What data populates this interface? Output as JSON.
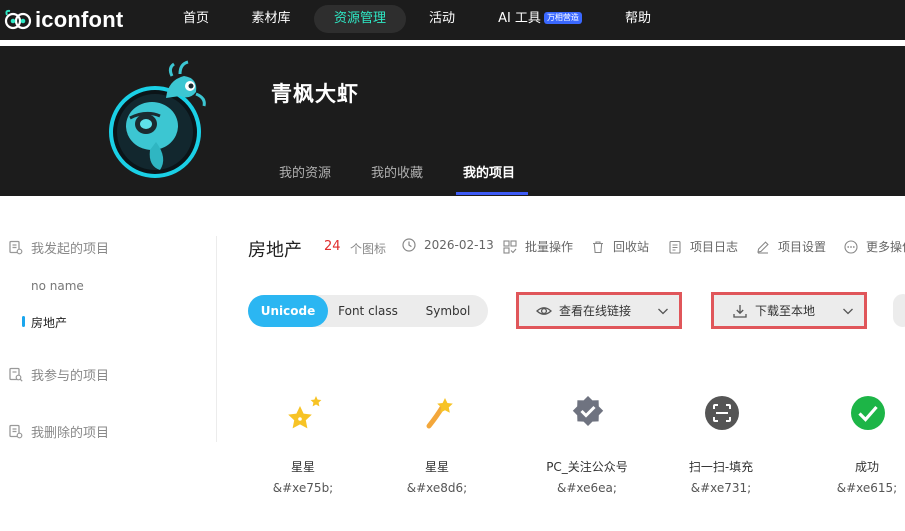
{
  "brand": {
    "name": "iconfont"
  },
  "topnav": {
    "items": [
      {
        "label": "首页"
      },
      {
        "label": "素材库"
      },
      {
        "label": "资源管理"
      },
      {
        "label": "活动"
      },
      {
        "label": "AI 工具",
        "badge": "万相营造"
      },
      {
        "label": "帮助"
      }
    ],
    "active_index": 2
  },
  "profile": {
    "username": "青枫大虾",
    "tabs": [
      {
        "label": "我的资源"
      },
      {
        "label": "我的收藏"
      },
      {
        "label": "我的项目"
      }
    ],
    "active_tab": 2
  },
  "sidebar": {
    "started_projects": "我发起的项目",
    "sub_items": [
      {
        "label": "no name"
      },
      {
        "label": "房地产"
      }
    ],
    "joined_projects": "我参与的项目",
    "deleted_projects": "我删除的项目"
  },
  "project": {
    "title": "房地产",
    "count": "24",
    "count_label": "个图标",
    "date": "2026-02-13",
    "actions": {
      "batch": "批量操作",
      "recycle": "回收站",
      "log": "项目日志",
      "settings": "项目设置",
      "more": "更多操作"
    }
  },
  "toolbar": {
    "modes": [
      {
        "label": "Unicode"
      },
      {
        "label": "Font class"
      },
      {
        "label": "Symbol"
      }
    ],
    "active_mode": 0,
    "online_link": "查看在线链接",
    "download": "下载至本地"
  },
  "icons": [
    {
      "name": "星星",
      "code": "&#xe75b;",
      "icon": "star-pair-icon"
    },
    {
      "name": "星星",
      "code": "&#xe8d6;",
      "icon": "shooting-star-icon"
    },
    {
      "name": "PC_关注公众号",
      "code": "&#xe6ea;",
      "icon": "verified-badge-icon"
    },
    {
      "name": "扫一扫-填充",
      "code": "&#xe731;",
      "icon": "scan-icon"
    },
    {
      "name": "成功",
      "code": "&#xe615;",
      "icon": "success-check-icon"
    }
  ],
  "colors": {
    "accent": "#2bb6f2",
    "nav_active": "#2ee8c5",
    "highlight_border": "#e0565a",
    "count_red": "#e02d2d",
    "tab_underline": "#3d5bf6"
  }
}
